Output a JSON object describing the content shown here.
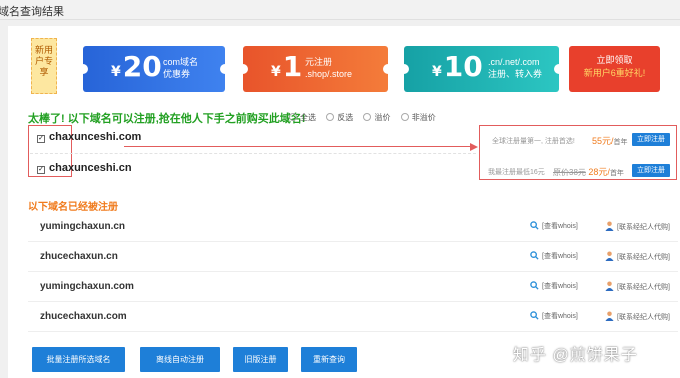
{
  "header": {
    "title": "域名查询结果"
  },
  "coupons": {
    "newuser_tag": "新用户专享",
    "c1": {
      "currency": "¥",
      "amount": "20",
      "line1": "com域名",
      "line2": "优惠券"
    },
    "c2": {
      "currency": "¥",
      "amount": "1",
      "line1": "元注册",
      "line2": ".shop/.store"
    },
    "c3": {
      "currency": "¥",
      "amount": "10",
      "line1": ".cn/.net/.com",
      "line2": "注册、转入券"
    },
    "c4": {
      "line1": "立即领取",
      "line2": "新用户6重好礼!"
    }
  },
  "available": {
    "heading": "太棒了! 以下域名可以注册,抢在他人下手之前购买此域名!",
    "filters": [
      "全选",
      "反选",
      "溢价",
      "非溢价"
    ],
    "rows": [
      {
        "domain": "chaxunceshi.com",
        "promo": "全球注册量第一, 注册首选!",
        "price": "55元/",
        "unit": "首年",
        "orig": "",
        "button": "立即注册"
      },
      {
        "domain": "chaxunceshi.cn",
        "promo": "我最注册最低16元",
        "price": "28元/",
        "unit": "首年",
        "orig": "原价38元",
        "button": "立即注册"
      }
    ]
  },
  "registered": {
    "heading": "以下域名已经被注册",
    "whois_label": "[查看whois]",
    "agent_label": "[联系经纪人代购]",
    "rows": [
      "yumingchaxun.cn",
      "zhucechaxun.cn",
      "yumingchaxun.com",
      "zhucechaxun.com"
    ]
  },
  "actions": {
    "batch": "批量注册所选域名",
    "offline": "离线自动注册",
    "old": "旧版注册",
    "requery": "重新查询"
  },
  "watermark": "知乎 @煎饼果子",
  "colors": {
    "accent_blue": "#1e7fd8",
    "green": "#22a022",
    "orange": "#f07b1d",
    "red_highlight": "#e25c5c"
  }
}
